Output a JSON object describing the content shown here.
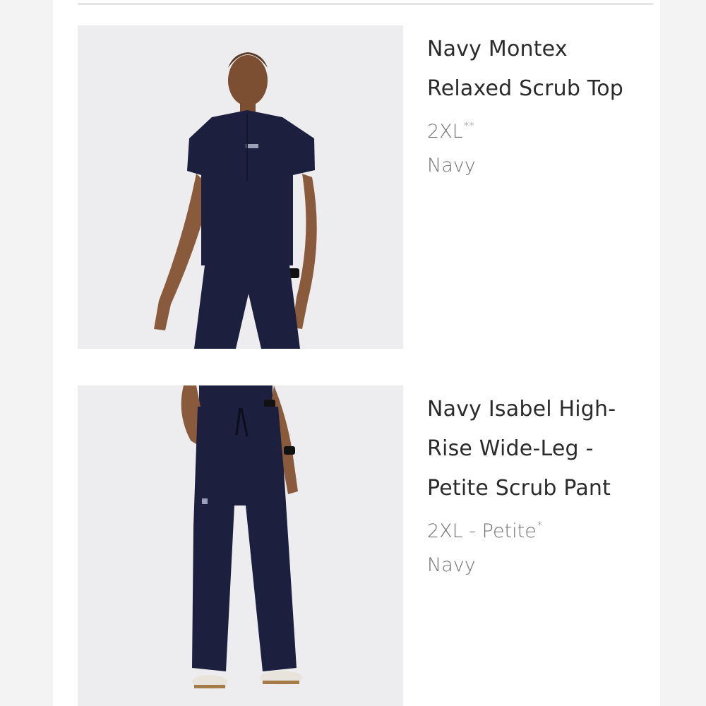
{
  "products": [
    {
      "name": "Navy Montex Relaxed Scrub Top",
      "size": "2XL",
      "size_mark": "**",
      "color": "Navy",
      "image": "Model wearing navy short-sleeve scrub top and navy pants"
    },
    {
      "name": "Navy Isabel High-Rise Wide-Leg - Petite Scrub Pant",
      "size": "2XL - Petite",
      "size_mark": "*",
      "color": "Navy",
      "image": "Model wearing navy wide-leg scrub pants with drawstring"
    }
  ],
  "colors": {
    "navy_garment": "#1c1f3e",
    "skin": "#8a5a3c",
    "photo_background": "#ededef"
  }
}
